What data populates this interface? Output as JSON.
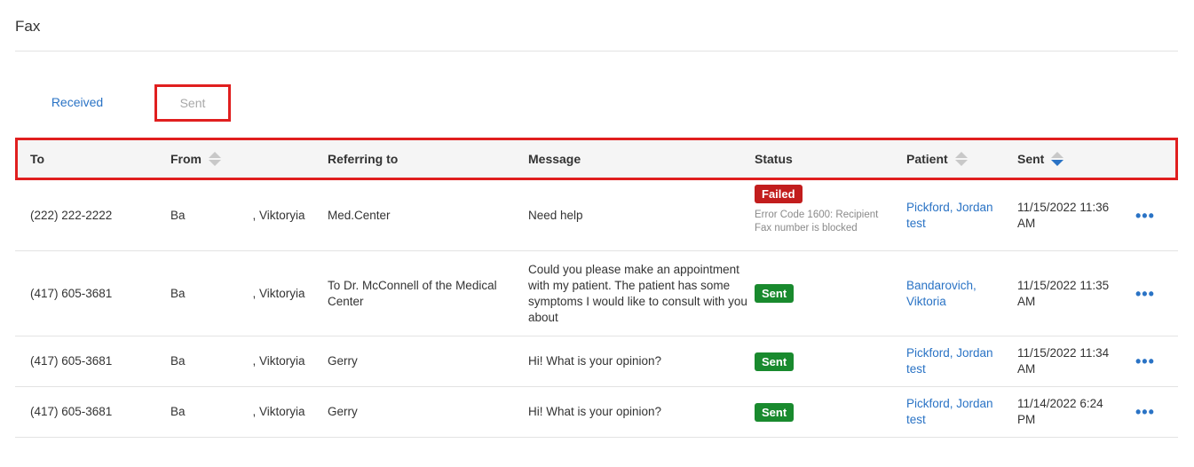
{
  "page": {
    "title": "Fax"
  },
  "tabs": {
    "received": "Received",
    "sent": "Sent"
  },
  "table": {
    "headers": {
      "to": "To",
      "from": "From",
      "referring_to": "Referring to",
      "message": "Message",
      "status": "Status",
      "patient": "Patient",
      "sent": "Sent"
    },
    "rows": [
      {
        "to": "(222) 222-2222",
        "from_first": "Ba",
        "from_last": ", Viktoryia",
        "referring_to": "Med.Center",
        "message": "Need help",
        "status": "Failed",
        "status_error": "Error Code 1600: Recipient Fax number is blocked",
        "patient": "Pickford, Jordan test",
        "sent": "11/15/2022 11:36 AM"
      },
      {
        "to": "(417) 605-3681",
        "from_first": "Ba",
        "from_last": ", Viktoryia",
        "referring_to": "To Dr. McConnell of the Medical Center",
        "message": "Could you please make an appointment with my patient. The patient has some symptoms I would like to consult with you about",
        "status": "Sent",
        "status_error": "",
        "patient": "Bandarovich, Viktoria",
        "sent": "11/15/2022 11:35 AM"
      },
      {
        "to": "(417) 605-3681",
        "from_first": "Ba",
        "from_last": ", Viktoryia",
        "referring_to": "Gerry",
        "message": "Hi! What is your opinion?",
        "status": "Sent",
        "status_error": "",
        "patient": "Pickford, Jordan test",
        "sent": "11/15/2022 11:34 AM"
      },
      {
        "to": "(417) 605-3681",
        "from_first": "Ba",
        "from_last": ", Viktoryia",
        "referring_to": "Gerry",
        "message": "Hi! What is your opinion?",
        "status": "Sent",
        "status_error": "",
        "patient": "Pickford, Jordan test",
        "sent": "11/14/2022 6:24 PM"
      }
    ]
  },
  "icons": {
    "more": "more-dots-icon",
    "sort": "sort-arrows-icon"
  },
  "colors": {
    "link": "#2a73c5",
    "failed": "#c21d1d",
    "sent": "#198a2e",
    "highlight": "#e01f1f"
  }
}
